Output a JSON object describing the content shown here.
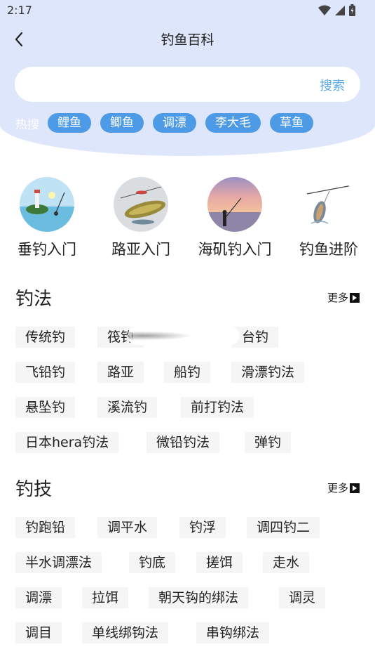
{
  "status_bar": {
    "time": "2:17"
  },
  "header": {
    "title": "钓鱼百科"
  },
  "search": {
    "placeholder": "",
    "button_label": "搜索"
  },
  "hot_search": {
    "label": "热搜",
    "tags": [
      "鲤鱼",
      "鲫鱼",
      "调漂",
      "李大毛",
      "草鱼"
    ]
  },
  "categories": [
    {
      "label": "垂钓入门",
      "image": "lighthouse-fishing"
    },
    {
      "label": "路亚入门",
      "image": "lure-fish"
    },
    {
      "label": "海矶钓入门",
      "image": "sunset-sea"
    },
    {
      "label": "钓鱼进阶",
      "image": "fish-on-hook"
    }
  ],
  "sections": [
    {
      "title": "钓法",
      "more_label": "更多",
      "items": [
        "传统钓",
        "筏钓",
        "台钓",
        "飞铅钓",
        "路亚",
        "船钓",
        "滑漂钓法",
        "悬坠钓",
        "溪流钓",
        "前打钓法",
        "日本hera钓法",
        "微铅钓法",
        "弹钓"
      ]
    },
    {
      "title": "钓技",
      "more_label": "更多",
      "items": [
        "钓跑铅",
        "调平水",
        "钓浮",
        "调四钓二",
        "半水调漂法",
        "钓底",
        "搓饵",
        "走水",
        "调漂",
        "拉饵",
        "朝天钩的绑法",
        "调灵",
        "调目",
        "单线绑钩法",
        "串钩绑法"
      ]
    }
  ],
  "colors": {
    "hero_bg": "#dde6fb",
    "tag_bg": "#4d9be6",
    "search_accent": "#5ea8e6",
    "chip_bg": "#f5f5f5"
  }
}
